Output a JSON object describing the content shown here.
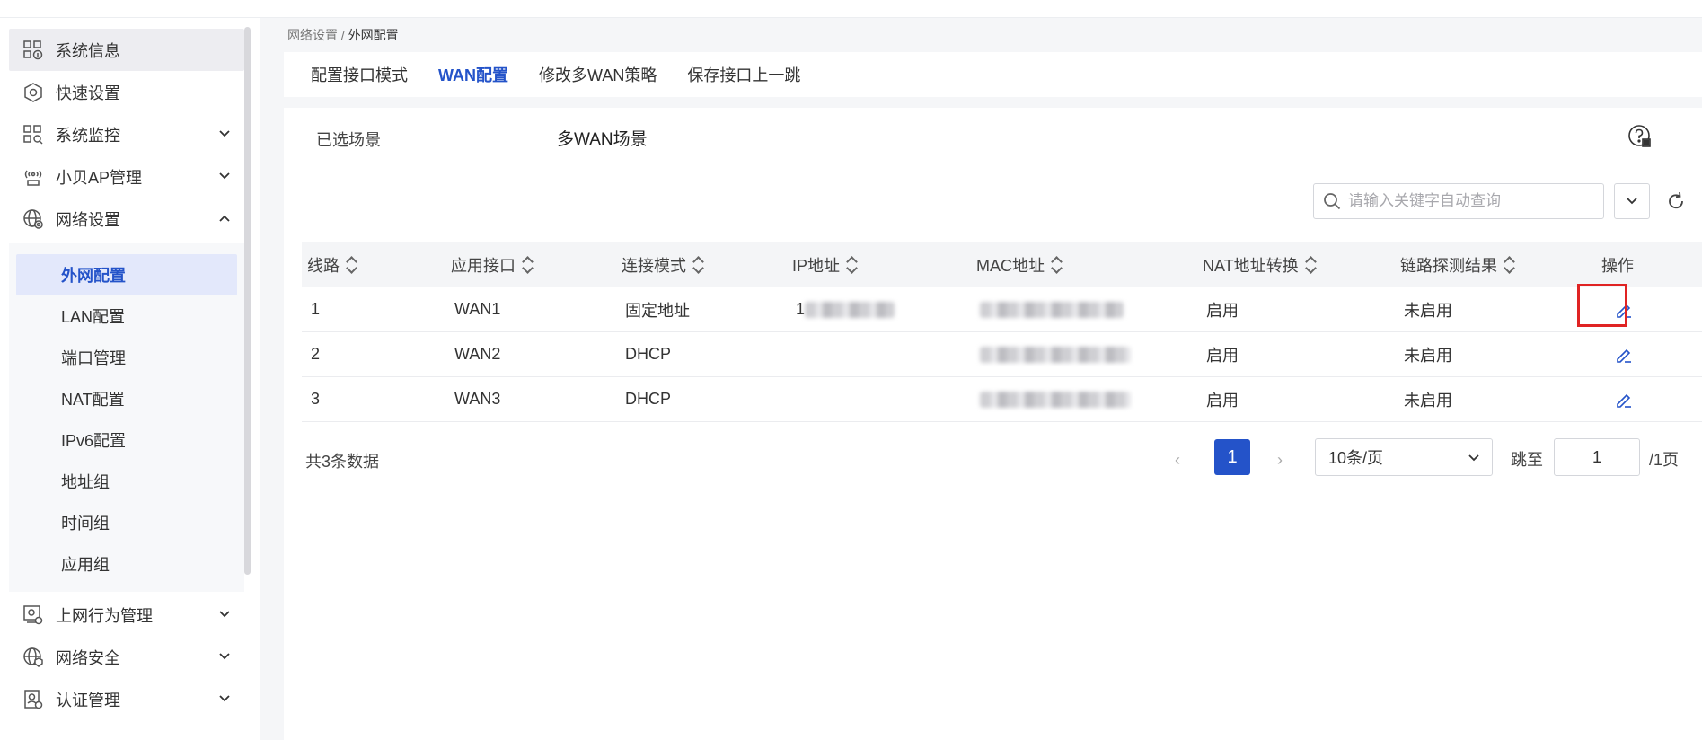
{
  "sidebar": {
    "items": [
      {
        "label": "系统信息",
        "icon": "system-info-icon",
        "active": true
      },
      {
        "label": "快速设置",
        "icon": "quick-settings-icon"
      },
      {
        "label": "系统监控",
        "icon": "system-monitor-icon",
        "expandable": true
      },
      {
        "label": "小贝AP管理",
        "icon": "ap-management-icon",
        "expandable": true
      },
      {
        "label": "网络设置",
        "icon": "network-settings-icon",
        "expanded": true
      }
    ],
    "submenu": [
      "外网配置",
      "LAN配置",
      "端口管理",
      "NAT配置",
      "IPv6配置",
      "地址组",
      "时间组",
      "应用组"
    ],
    "bottom_items": [
      {
        "label": "上网行为管理",
        "icon": "behavior-management-icon"
      },
      {
        "label": "网络安全",
        "icon": "network-security-icon"
      },
      {
        "label": "认证管理",
        "icon": "auth-management-icon"
      }
    ]
  },
  "breadcrumb": {
    "parent": "网络设置",
    "sep": " / ",
    "current": "外网配置"
  },
  "tabs": [
    "配置接口模式",
    "WAN配置",
    "修改多WAN策略",
    "保存接口上一跳"
  ],
  "active_tab": "WAN配置",
  "scene": {
    "label": "已选场景",
    "value": "多WAN场景"
  },
  "search": {
    "placeholder": "请输入关键字自动查询",
    "value": ""
  },
  "table": {
    "headers": [
      "线路",
      "应用接口",
      "连接模式",
      "IP地址",
      "MAC地址",
      "NAT地址转换",
      "链路探测结果",
      "操作"
    ],
    "rows": [
      {
        "line": "1",
        "iface": "WAN1",
        "mode": "固定地址",
        "ip_prefix": "1",
        "ip_blurred": true,
        "nat": "启用",
        "probe": "未启用"
      },
      {
        "line": "2",
        "iface": "WAN2",
        "mode": "DHCP",
        "ip_prefix": "",
        "ip_blurred": false,
        "nat": "启用",
        "probe": "未启用"
      },
      {
        "line": "3",
        "iface": "WAN3",
        "mode": "DHCP",
        "ip_prefix": "",
        "ip_blurred": false,
        "nat": "启用",
        "probe": "未启用"
      }
    ]
  },
  "pagination": {
    "total": "共3条数据",
    "current": "1",
    "page_size": "10条/页",
    "goto_label": "跳至",
    "goto_value": "1",
    "suffix": "/1页"
  },
  "colors": {
    "accent": "#2453c9",
    "highlight_box": "#e02323"
  }
}
